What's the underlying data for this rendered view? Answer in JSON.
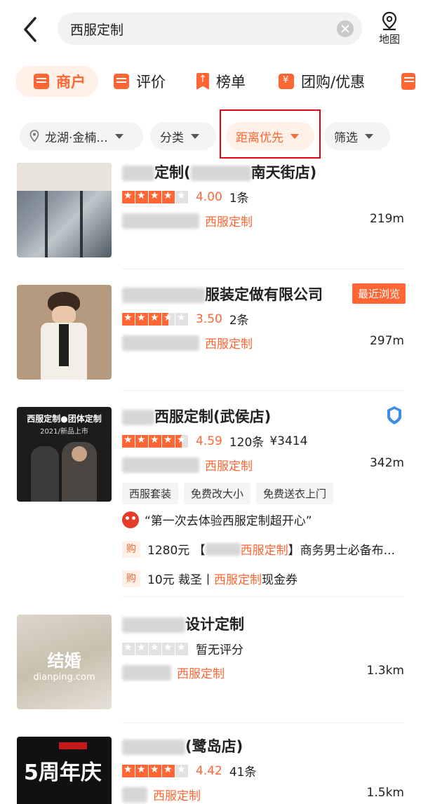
{
  "header": {
    "search_query": "西服定制",
    "map_label": "地图"
  },
  "tabs": [
    {
      "label": "商户"
    },
    {
      "label": "评价"
    },
    {
      "label": "榜单"
    },
    {
      "label": "团购/优惠"
    }
  ],
  "filters": {
    "location": "龙湖·金楠...",
    "category": "分类",
    "sort": "距离优先",
    "screen": "筛选"
  },
  "results": [
    {
      "name_visible_1": "定制(",
      "name_visible_2": "南天街店)",
      "stars": 4,
      "score": "4.00",
      "reviews": "1条",
      "category": "西服定制",
      "distance": "219m"
    },
    {
      "name_visible": "服装定做有限公司",
      "badge": "最近浏览",
      "stars": 3.5,
      "score": "3.50",
      "reviews": "2条",
      "category": "西服定制",
      "distance": "297m"
    },
    {
      "name_visible": "西服定制(武侯店)",
      "stars": 4.5,
      "score": "4.59",
      "reviews": "120条",
      "price": "¥3414",
      "category": "西服定制",
      "distance": "342m",
      "tags": [
        "西服套装",
        "免费改大小",
        "免费送衣上门"
      ],
      "quote": "“第一次去体验西服定制超开心”",
      "deals": [
        {
          "tag": "购",
          "prefix": "1280元 【",
          "highlight": "西服定制",
          "suffix": "】商务男士必备布..."
        },
        {
          "tag": "购",
          "prefix": "10元 裁圣丨",
          "highlight": "西服定制",
          "suffix": "现金券"
        }
      ],
      "thumb_text_1": "西服定制●团体定制",
      "thumb_text_2": "2021/新品上市"
    },
    {
      "name_visible": "设计定制",
      "stars": 0,
      "no_rating": "暂无评分",
      "category": "西服定制",
      "distance": "1.3km",
      "thumb_text_1": "结婚",
      "thumb_text_2": "dianping.com"
    },
    {
      "name_visible": "(鹭岛店)",
      "stars": 4,
      "score": "4.42",
      "reviews": "41条",
      "category": "西服定制",
      "distance": "1.5km",
      "thumb_text_1": "5周年庆"
    }
  ]
}
